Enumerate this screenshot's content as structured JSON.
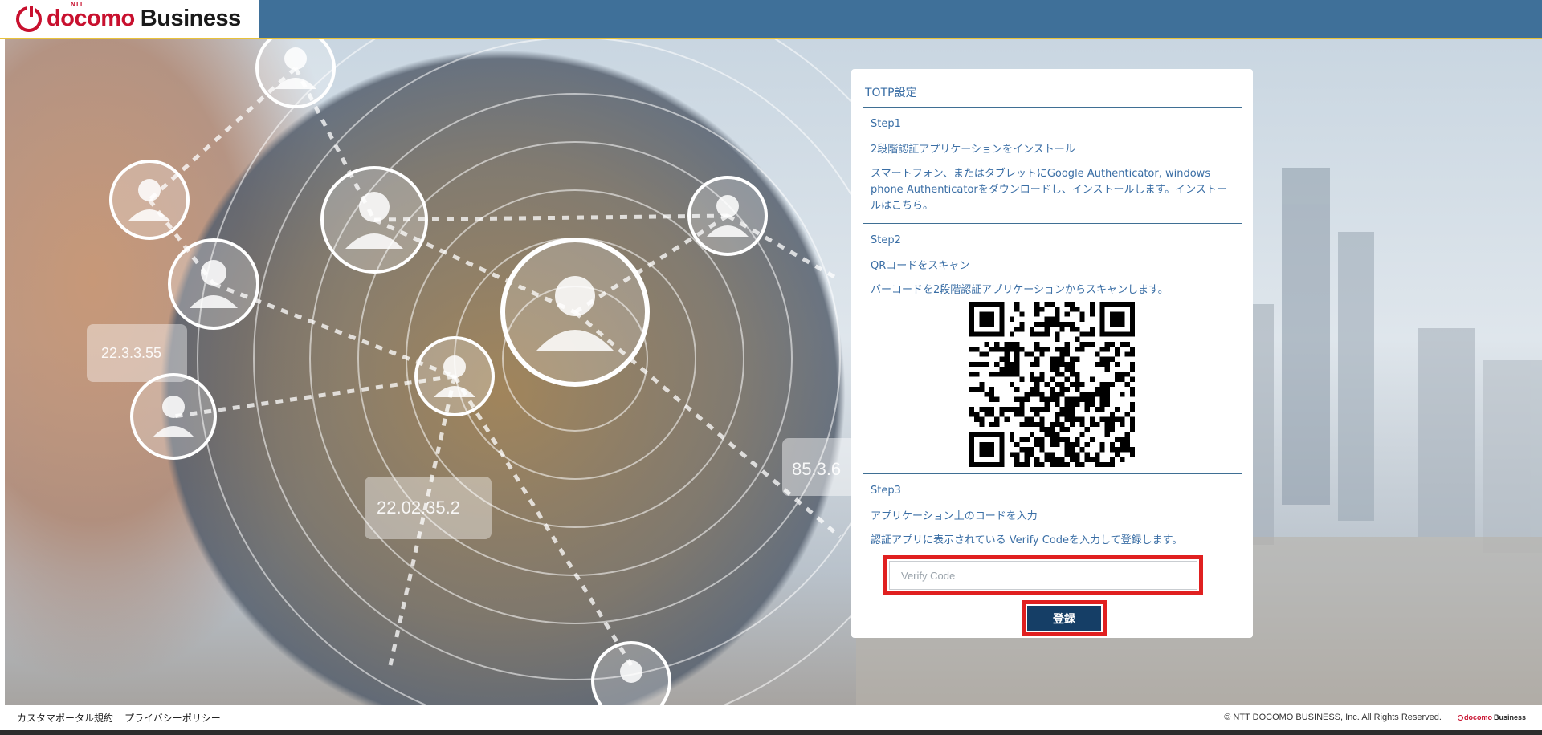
{
  "header": {
    "logo_ntt": "NTT",
    "logo_docomo": "docomo",
    "logo_business": "Business"
  },
  "hero": {
    "bubbles": [
      "22.3.3.55",
      "22.02.35.2",
      "85.3.6"
    ]
  },
  "card": {
    "title": "TOTP設定",
    "step1": {
      "label": "Step1",
      "heading": "2段階認証アプリケーションをインストール",
      "description": "スマートフォン、またはタブレットにGoogle Authenticator, windows phone Authenticatorをダウンロードし、インストールします。インストールはこちら。"
    },
    "step2": {
      "label": "Step2",
      "heading": "QRコードをスキャン",
      "description": "バーコードを2段階認証アプリケーションからスキャンします。"
    },
    "step3": {
      "label": "Step3",
      "heading": "アプリケーション上のコードを入力",
      "description": "認証アプリに表示されている Verify Codeを入力して登録します。"
    },
    "verify_input": {
      "placeholder": "Verify Code",
      "value": ""
    },
    "submit_label": "登録"
  },
  "footer": {
    "links": [
      "カスタマポータル規約",
      "プライバシーポリシー"
    ],
    "copyright": "© NTT DOCOMO BUSINESS, Inc. All Rights Reserved.",
    "logo_docomo": "docomo",
    "logo_business": "Business"
  },
  "colors": {
    "header_bg": "#3f7099",
    "header_accent": "#e8c23a",
    "brand_red": "#c8102e",
    "card_text": "#3a6ea5",
    "button_bg": "#153e66",
    "highlight": "#e02020"
  }
}
